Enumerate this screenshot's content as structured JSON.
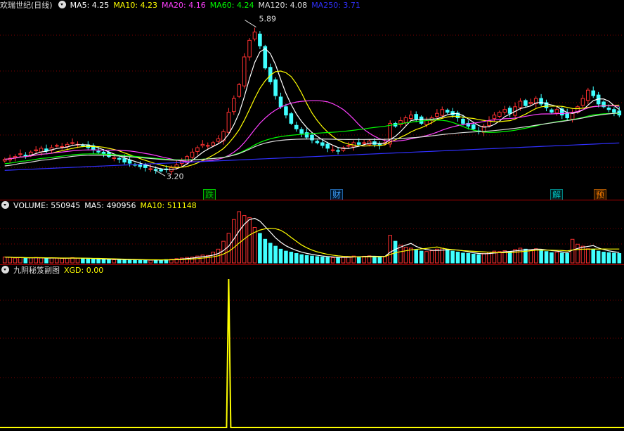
{
  "main": {
    "stock_name": "欢瑞世纪(日线)",
    "ma5": "MA5: 4.25",
    "ma10": "MA10: 4.23",
    "ma20": "MA20: 4.16",
    "ma60": "MA60: 4.24",
    "ma120": "MA120: 4.08",
    "ma250": "MA250: 3.71",
    "high_label": "5.89",
    "low_label": "3.20",
    "event_markers": [
      {
        "text": "跌",
        "color": "#00c000"
      },
      {
        "text": "财",
        "color": "#40a0ff"
      },
      {
        "text": "解",
        "color": "#00c0c0"
      },
      {
        "text": "预",
        "color": "#ff8000"
      }
    ],
    "colors": {
      "ma5": "#ffffff",
      "ma10": "#ffff00",
      "ma20": "#ff40ff",
      "ma60": "#00ff00",
      "ma120": "#dddddd",
      "ma250": "#3030ff",
      "up": "#ff3030",
      "down": "#40ffff"
    }
  },
  "volume": {
    "label": "VOLUME: 550945",
    "ma5": "MA5: 490956",
    "ma10": "MA10: 511148"
  },
  "indicator": {
    "name": "九阴秘笈副图",
    "xgd": "XGD: 0.00"
  },
  "chart_data": {
    "type": "candlestick",
    "price_range": [
      3.2,
      5.89
    ],
    "closes": [
      3.45,
      3.47,
      3.5,
      3.55,
      3.52,
      3.58,
      3.62,
      3.65,
      3.6,
      3.66,
      3.7,
      3.68,
      3.72,
      3.75,
      3.72,
      3.7,
      3.66,
      3.62,
      3.58,
      3.55,
      3.5,
      3.48,
      3.45,
      3.4,
      3.38,
      3.35,
      3.32,
      3.3,
      3.28,
      3.25,
      3.24,
      3.26,
      3.3,
      3.35,
      3.42,
      3.5,
      3.58,
      3.66,
      3.72,
      3.7,
      3.75,
      3.82,
      3.95,
      4.3,
      4.55,
      4.8,
      5.3,
      5.6,
      5.75,
      5.5,
      5.1,
      4.85,
      4.6,
      4.4,
      4.25,
      4.1,
      4.0,
      3.92,
      3.85,
      3.8,
      3.75,
      3.7,
      3.65,
      3.62,
      3.6,
      3.66,
      3.7,
      3.75,
      3.72,
      3.75,
      3.78,
      3.72,
      3.7,
      3.75,
      4.1,
      4.05,
      4.15,
      4.2,
      4.25,
      4.18,
      4.1,
      4.15,
      4.2,
      4.28,
      4.35,
      4.3,
      4.25,
      4.2,
      4.1,
      4.05,
      4.0,
      3.95,
      4.05,
      4.15,
      4.25,
      4.3,
      4.35,
      4.28,
      4.4,
      4.5,
      4.42,
      4.48,
      4.55,
      4.45,
      4.38,
      4.3,
      4.35,
      4.25,
      4.2,
      4.3,
      4.4,
      4.55,
      4.7,
      4.6,
      4.45,
      4.4,
      4.35,
      4.3,
      4.25
    ],
    "volumes": [
      30,
      28,
      25,
      27,
      24,
      26,
      28,
      25,
      22,
      26,
      24,
      23,
      25,
      27,
      24,
      22,
      21,
      20,
      19,
      18,
      17,
      16,
      18,
      17,
      16,
      15,
      16,
      15,
      14,
      15,
      16,
      17,
      19,
      22,
      25,
      28,
      30,
      35,
      40,
      38,
      55,
      70,
      110,
      150,
      220,
      260,
      240,
      230,
      180,
      150,
      120,
      100,
      85,
      70,
      60,
      55,
      48,
      42,
      38,
      35,
      32,
      30,
      28,
      27,
      26,
      30,
      33,
      35,
      32,
      34,
      36,
      33,
      30,
      32,
      140,
      110,
      90,
      80,
      75,
      65,
      60,
      58,
      62,
      70,
      75,
      68,
      60,
      55,
      50,
      48,
      45,
      42,
      48,
      55,
      60,
      58,
      62,
      57,
      68,
      75,
      70,
      66,
      72,
      65,
      58,
      52,
      55,
      50,
      48,
      120,
      95,
      85,
      72,
      68,
      60,
      55,
      52,
      50,
      48
    ],
    "xgd_peak_index": 43,
    "xgd_peak_value": 1
  }
}
